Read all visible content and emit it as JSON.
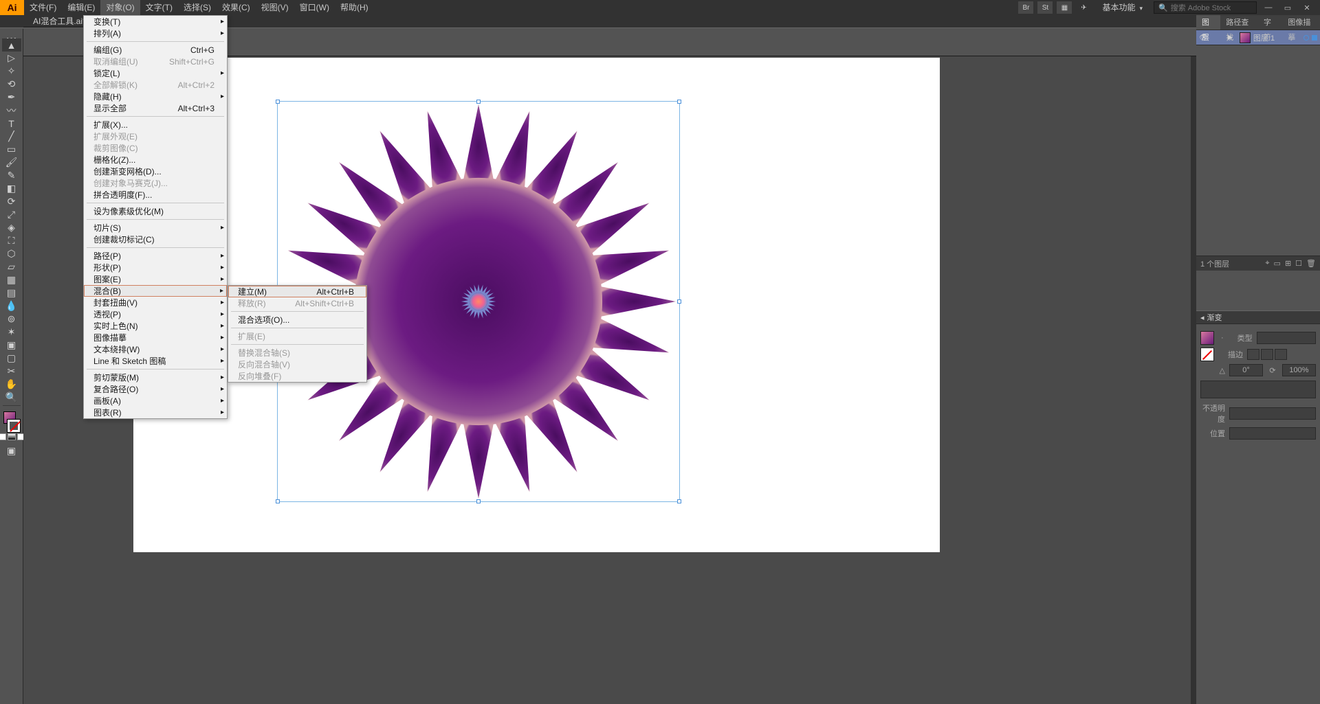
{
  "app": {
    "logo": "Ai"
  },
  "menubar": [
    {
      "label": "文件(F)"
    },
    {
      "label": "编辑(E)"
    },
    {
      "label": "对象(O)",
      "active": true
    },
    {
      "label": "文字(T)"
    },
    {
      "label": "选择(S)"
    },
    {
      "label": "效果(C)"
    },
    {
      "label": "视图(V)"
    },
    {
      "label": "窗口(W)"
    },
    {
      "label": "帮助(H)"
    }
  ],
  "workspace": "基本功能",
  "search_placeholder": "搜索 Adobe Stock",
  "doc_tab": "AI混合工具.ai* @",
  "object_menu": [
    {
      "label": "变换(T)",
      "sub": true
    },
    {
      "label": "排列(A)",
      "sub": true
    },
    {
      "sep": true
    },
    {
      "label": "编组(G)",
      "shortcut": "Ctrl+G"
    },
    {
      "label": "取消编组(U)",
      "shortcut": "Shift+Ctrl+G",
      "disabled": true
    },
    {
      "label": "锁定(L)",
      "sub": true
    },
    {
      "label": "全部解锁(K)",
      "shortcut": "Alt+Ctrl+2",
      "disabled": true
    },
    {
      "label": "隐藏(H)",
      "sub": true
    },
    {
      "label": "显示全部",
      "shortcut": "Alt+Ctrl+3"
    },
    {
      "sep": true
    },
    {
      "label": "扩展(X)..."
    },
    {
      "label": "扩展外观(E)",
      "disabled": true
    },
    {
      "label": "裁剪图像(C)",
      "disabled": true
    },
    {
      "label": "栅格化(Z)..."
    },
    {
      "label": "创建渐变网格(D)..."
    },
    {
      "label": "创建对象马赛克(J)...",
      "disabled": true
    },
    {
      "label": "拼合透明度(F)..."
    },
    {
      "sep": true
    },
    {
      "label": "设为像素级优化(M)"
    },
    {
      "sep": true
    },
    {
      "label": "切片(S)",
      "sub": true
    },
    {
      "label": "创建裁切标记(C)"
    },
    {
      "sep": true
    },
    {
      "label": "路径(P)",
      "sub": true
    },
    {
      "label": "形状(P)",
      "sub": true
    },
    {
      "label": "图案(E)",
      "sub": true
    },
    {
      "label": "混合(B)",
      "sub": true,
      "hover": true
    },
    {
      "label": "封套扭曲(V)",
      "sub": true
    },
    {
      "label": "透视(P)",
      "sub": true
    },
    {
      "label": "实时上色(N)",
      "sub": true
    },
    {
      "label": "图像描摹",
      "sub": true
    },
    {
      "label": "文本绕排(W)",
      "sub": true
    },
    {
      "label": "Line 和 Sketch 图稿",
      "sub": true
    },
    {
      "sep": true
    },
    {
      "label": "剪切蒙版(M)",
      "sub": true
    },
    {
      "label": "复合路径(O)",
      "sub": true
    },
    {
      "label": "画板(A)",
      "sub": true
    },
    {
      "label": "图表(R)",
      "sub": true
    }
  ],
  "blend_submenu": [
    {
      "label": "建立(M)",
      "shortcut": "Alt+Ctrl+B",
      "hover": true
    },
    {
      "label": "释放(R)",
      "shortcut": "Alt+Shift+Ctrl+B",
      "disabled": true
    },
    {
      "sep": true
    },
    {
      "label": "混合选项(O)..."
    },
    {
      "sep": true
    },
    {
      "label": "扩展(E)",
      "disabled": true
    },
    {
      "sep": true
    },
    {
      "label": "替换混合轴(S)",
      "disabled": true
    },
    {
      "label": "反向混合轴(V)",
      "disabled": true
    },
    {
      "label": "反向堆叠(F)",
      "disabled": true
    }
  ],
  "tools": [
    "selection",
    "direct-select",
    "magic-wand",
    "lasso",
    "pen",
    "curvature",
    "type",
    "line",
    "rectangle",
    "brush",
    "shaper",
    "eraser",
    "rotate",
    "scale",
    "width",
    "free-transform",
    "shape-builder",
    "perspective",
    "mesh",
    "gradient",
    "eyedropper",
    "blend",
    "symbol-sprayer",
    "graph",
    "artboard",
    "slice",
    "hand",
    "zoom"
  ],
  "layers": {
    "tabs": [
      "图层",
      "路径查找",
      "字符",
      "图像描摹"
    ],
    "row": {
      "name": "图层 1"
    },
    "footer": "1 个图层"
  },
  "gradient_panel": {
    "title": "渐变",
    "type_label": "类型",
    "stroke_label": "描边",
    "angle_value": "0°",
    "ratio_value": "100%",
    "opacity_label": "不透明度",
    "position_label": "位置"
  }
}
